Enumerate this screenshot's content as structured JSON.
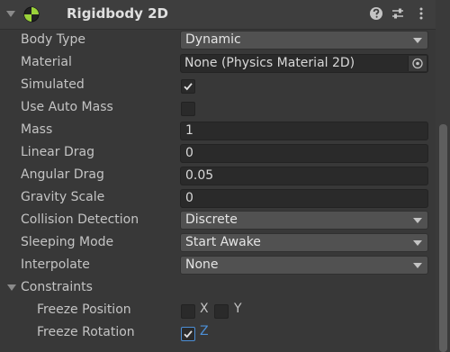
{
  "component": {
    "title": "Rigidbody 2D",
    "icon": "rigidbody2d-icon",
    "header_icons": [
      "help-icon",
      "preset-icon",
      "kebab-menu-icon"
    ]
  },
  "properties": {
    "body_type": {
      "label": "Body Type",
      "value": "Dynamic"
    },
    "material": {
      "label": "Material",
      "value": "None (Physics Material 2D)"
    },
    "simulated": {
      "label": "Simulated",
      "checked": true
    },
    "use_auto_mass": {
      "label": "Use Auto Mass",
      "checked": false
    },
    "mass": {
      "label": "Mass",
      "value": "1"
    },
    "linear_drag": {
      "label": "Linear Drag",
      "value": "0"
    },
    "angular_drag": {
      "label": "Angular Drag",
      "value": "0.05"
    },
    "gravity_scale": {
      "label": "Gravity Scale",
      "value": "0"
    },
    "collision_detection": {
      "label": "Collision Detection",
      "value": "Discrete"
    },
    "sleeping_mode": {
      "label": "Sleeping Mode",
      "value": "Start Awake"
    },
    "interpolate": {
      "label": "Interpolate",
      "value": "None"
    }
  },
  "constraints": {
    "label": "Constraints",
    "freeze_position": {
      "label": "Freeze Position",
      "x_label": "X",
      "x_checked": false,
      "y_label": "Y",
      "y_checked": false
    },
    "freeze_rotation": {
      "label": "Freeze Rotation",
      "z_label": "Z",
      "z_checked": true
    }
  },
  "colors": {
    "accent": "#4c8fd6",
    "panel": "#383838",
    "field": "#2a2a2a"
  }
}
